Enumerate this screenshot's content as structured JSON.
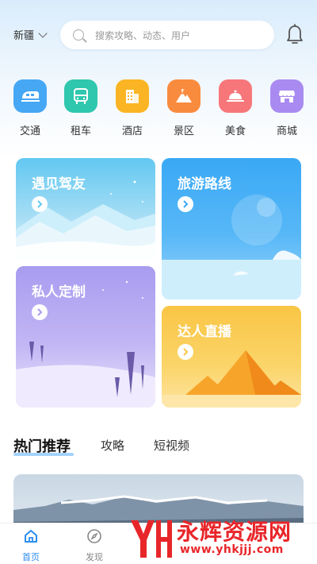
{
  "header": {
    "region": "新疆",
    "search_placeholder": "搜索攻略、动态、用户"
  },
  "categories": [
    {
      "label": "交通",
      "icon": "train-icon",
      "color": "#46a7f5"
    },
    {
      "label": "租车",
      "icon": "bus-icon",
      "color": "#2fc7ad"
    },
    {
      "label": "酒店",
      "icon": "hotel-icon",
      "color": "#fbb524"
    },
    {
      "label": "景区",
      "icon": "mountain-icon",
      "color": "#f98b3f"
    },
    {
      "label": "美食",
      "icon": "dish-icon",
      "color": "#f7767a"
    },
    {
      "label": "商城",
      "icon": "shop-icon",
      "color": "#a98af0"
    }
  ],
  "cards": {
    "drivers": {
      "title": "遇见驾友"
    },
    "routes": {
      "title": "旅游路线"
    },
    "custom": {
      "title": "私人定制"
    },
    "live": {
      "title": "达人直播"
    }
  },
  "tabs": {
    "hot": "热门推荐",
    "guides": "攻略",
    "videos": "短视频"
  },
  "nav": {
    "home": "首页",
    "discover": "发现"
  },
  "watermark": {
    "brand": "永辉资源网",
    "url": "www.yhkjjj.com"
  },
  "colors": {
    "accent": "#2a8cf0",
    "tab_underline": "#8ec7ff"
  }
}
